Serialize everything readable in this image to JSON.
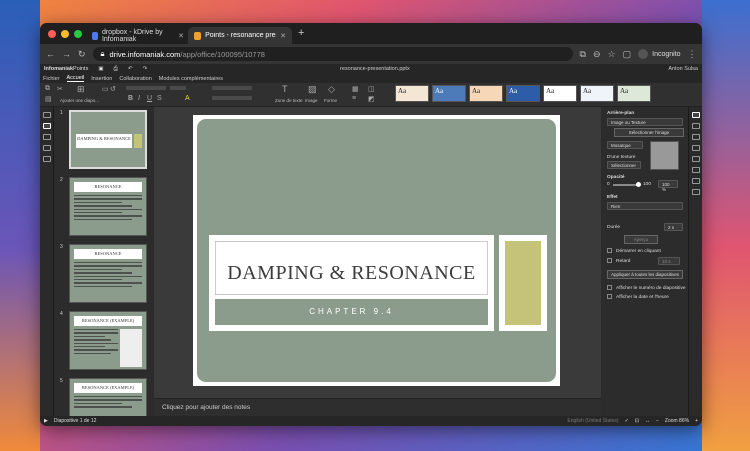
{
  "browser": {
    "tabs": [
      {
        "label": "dropbox - kDrive by Infomaniak",
        "active": false
      },
      {
        "label": "Points - resonance presentation",
        "active": true
      }
    ],
    "url_host": "drive.infomaniak.com",
    "url_path": "/app/office/100095/10778",
    "incognito_label": "Incognito"
  },
  "app": {
    "brand": "Infomaniak",
    "product": "Points",
    "document_name": "resonance-presentation.pptx",
    "user_name": "Anton Sulsa"
  },
  "menu": [
    "Fichier",
    "Accueil",
    "Insertion",
    "Collaboration",
    "Modules complémentaires"
  ],
  "toolbar": {
    "add_slide_label": "Ajouter une diapo...",
    "textbox_label": "Zone de texte",
    "image_label": "Image",
    "shape_label": "Forme",
    "theme_thumbs": [
      "Aa",
      "Aa",
      "Aa",
      "Aa",
      "Aa",
      "Aa",
      "Aa"
    ]
  },
  "slides": [
    {
      "num": "1",
      "title": "DAMPING & RESONANCE",
      "subtitle": "CHAPTER 9.4"
    },
    {
      "num": "2",
      "title": "RESONANCE"
    },
    {
      "num": "3",
      "title": "RESONANCE"
    },
    {
      "num": "4",
      "title": "RESONANCE (EXAMPLE)"
    },
    {
      "num": "5",
      "title": "RESONANCE (EXAMPLE)"
    }
  ],
  "current_slide": {
    "title": "DAMPING & RESONANCE",
    "subtitle": "CHAPTER 9.4"
  },
  "notes_placeholder": "Cliquez pour ajouter des notes",
  "panel": {
    "section": "Arrière-plan",
    "fill_type": "Image ou Texture",
    "select_image": "Sélectionner l'image",
    "tile": "Mosaïque",
    "texture_label": "D'une texture",
    "texture_select": "Sélectionner",
    "opacity_label": "Opacité",
    "opacity_min": "0",
    "opacity_max": "100",
    "opacity_value": "100 %",
    "effect_label": "Effet",
    "effect_value": "Rien",
    "duration_label": "Durée",
    "duration_value": "2 s",
    "preview_label": "Aperçu",
    "start_on_click": "Démarrer en cliquant",
    "delay_label": "Retard",
    "delay_value": "10 s",
    "apply_all": "Appliquer à toutes les diapositives",
    "show_slide_number": "Afficher le numéro de diapositive",
    "show_date_time": "Afficher la date et l'heure"
  },
  "status": {
    "slide_counter": "Diapositive 1 de 12",
    "language": "English (United States)",
    "zoom": "Zoom 86%"
  },
  "colors": {
    "slide_bg": "#8c9c8c",
    "accent": "#c5c27a"
  }
}
